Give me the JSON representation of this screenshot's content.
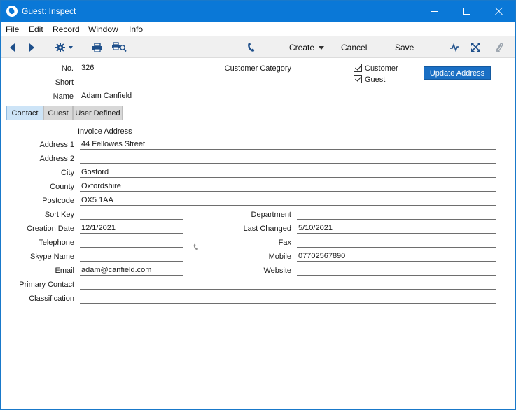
{
  "window": {
    "title": "Guest: Inspect"
  },
  "menu": [
    "File",
    "Edit",
    "Record",
    "Window",
    "Info"
  ],
  "toolbar": {
    "create_label": "Create",
    "cancel_label": "Cancel",
    "save_label": "Save"
  },
  "header": {
    "no_label": "No.",
    "no_value": "326",
    "short_label": "Short",
    "short_value": "",
    "name_label": "Name",
    "name_value": "Adam Canfield",
    "customer_category_label": "Customer Category",
    "customer_category_value": "",
    "customer_checkbox_label": "Customer",
    "guest_checkbox_label": "Guest",
    "update_address_label": "Update Address"
  },
  "tabs": [
    "Contact",
    "Guest",
    "User Defined"
  ],
  "contact": {
    "invoice_address_heading": "Invoice Address",
    "address1_label": "Address 1",
    "address1_value": "44 Fellowes Street",
    "address2_label": "Address 2",
    "address2_value": "",
    "city_label": "City",
    "city_value": "Gosford",
    "county_label": "County",
    "county_value": "Oxfordshire",
    "postcode_label": "Postcode",
    "postcode_value": "OX5 1AA",
    "sort_key_label": "Sort Key",
    "sort_key_value": "",
    "department_label": "Department",
    "department_value": "",
    "creation_date_label": "Creation Date",
    "creation_date_value": "12/1/2021",
    "last_changed_label": "Last Changed",
    "last_changed_value": "5/10/2021",
    "telephone_label": "Telephone",
    "telephone_value": "",
    "fax_label": "Fax",
    "fax_value": "",
    "skype_label": "Skype Name",
    "skype_value": "",
    "mobile_label": "Mobile",
    "mobile_value": "07702567890",
    "email_label": "Email",
    "email_value": "adam@canfield.com",
    "website_label": "Website",
    "website_value": "",
    "primary_contact_label": "Primary Contact",
    "primary_contact_value": "",
    "classification_label": "Classification",
    "classification_value": ""
  },
  "colors": {
    "titlebar": "#0a78d7",
    "accent_button": "#1a6fc4",
    "active_tab": "#cde4f7"
  },
  "icons": [
    "app-icon",
    "minimize-icon",
    "maximize-icon",
    "close-icon",
    "back-arrow-icon",
    "forward-arrow-icon",
    "gear-icon",
    "printer-icon",
    "print-preview-icon",
    "phone-icon",
    "activity-icon",
    "expand-icon",
    "paperclip-icon"
  ]
}
